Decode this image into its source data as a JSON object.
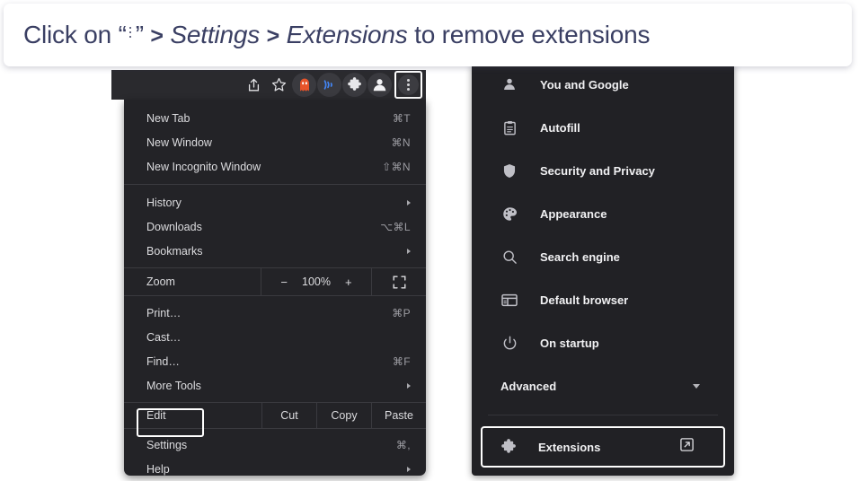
{
  "header": {
    "prefix": "Click on “",
    "kebab_icon": "vertical-ellipsis-icon",
    "after_kebab": "”",
    "sep1": ">",
    "italic1": "Settings",
    "sep2": ">",
    "italic2": "Extensions",
    "suffix": "to remove extensions",
    "text_color": "#3a3f63"
  },
  "browser_toolbar": {
    "icons": [
      {
        "name": "share-icon",
        "label": "Share"
      },
      {
        "name": "bookmark-star-icon",
        "label": "Bookmark this tab"
      },
      {
        "name": "extension-avatar-icon",
        "label": "Extension",
        "color": "#e8542a"
      },
      {
        "name": "cast-icon",
        "label": "Cast",
        "color": "#4285f4"
      },
      {
        "name": "puzzle-piece-icon",
        "label": "Extensions"
      },
      {
        "name": "profile-avatar-icon",
        "label": "Profile"
      },
      {
        "name": "three-dot-menu-icon",
        "label": "Customize and control Google Chrome",
        "highlighted": true
      }
    ]
  },
  "chrome_menu": {
    "groups": [
      {
        "items": [
          {
            "label": "New Tab",
            "accel": "⌘T",
            "submenu": false
          },
          {
            "label": "New Window",
            "accel": "⌘N",
            "submenu": false
          },
          {
            "label": "New Incognito Window",
            "accel": "⇧⌘N",
            "submenu": false
          }
        ]
      },
      {
        "items": [
          {
            "label": "History",
            "accel": "",
            "submenu": true
          },
          {
            "label": "Downloads",
            "accel": "⌥⌘L",
            "submenu": false
          },
          {
            "label": "Bookmarks",
            "accel": "",
            "submenu": true
          }
        ]
      }
    ],
    "zoom_row": {
      "label": "Zoom",
      "minus": "−",
      "value": "100%",
      "plus": "+",
      "fullscreen_icon": "fullscreen-icon"
    },
    "group3": {
      "items": [
        {
          "label": "Print…",
          "accel": "⌘P",
          "submenu": false
        },
        {
          "label": "Cast…",
          "accel": "",
          "submenu": false
        },
        {
          "label": "Find…",
          "accel": "⌘F",
          "submenu": false
        },
        {
          "label": "More Tools",
          "accel": "",
          "submenu": true
        }
      ]
    },
    "edit_row": {
      "label": "Edit",
      "cut": "Cut",
      "copy": "Copy",
      "paste": "Paste"
    },
    "group4": {
      "items": [
        {
          "label": "Settings",
          "accel": "⌘,",
          "submenu": false,
          "highlighted": true
        },
        {
          "label": "Help",
          "accel": "",
          "submenu": true
        }
      ]
    }
  },
  "settings_panel": {
    "items": [
      {
        "label": "You and Google",
        "icon": "person-icon"
      },
      {
        "label": "Autofill",
        "icon": "clipboard-icon"
      },
      {
        "label": "Security and Privacy",
        "icon": "shield-icon"
      },
      {
        "label": "Appearance",
        "icon": "palette-icon"
      },
      {
        "label": "Search engine",
        "icon": "magnifier-icon"
      },
      {
        "label": "Default browser",
        "icon": "browser-window-icon"
      },
      {
        "label": "On startup",
        "icon": "power-icon"
      }
    ],
    "advanced": {
      "label": "Advanced",
      "icon": "chevron-down-icon"
    },
    "extensions": {
      "label": "Extensions",
      "icon": "puzzle-piece-icon",
      "open_icon": "external-link-icon",
      "highlighted": true
    }
  }
}
